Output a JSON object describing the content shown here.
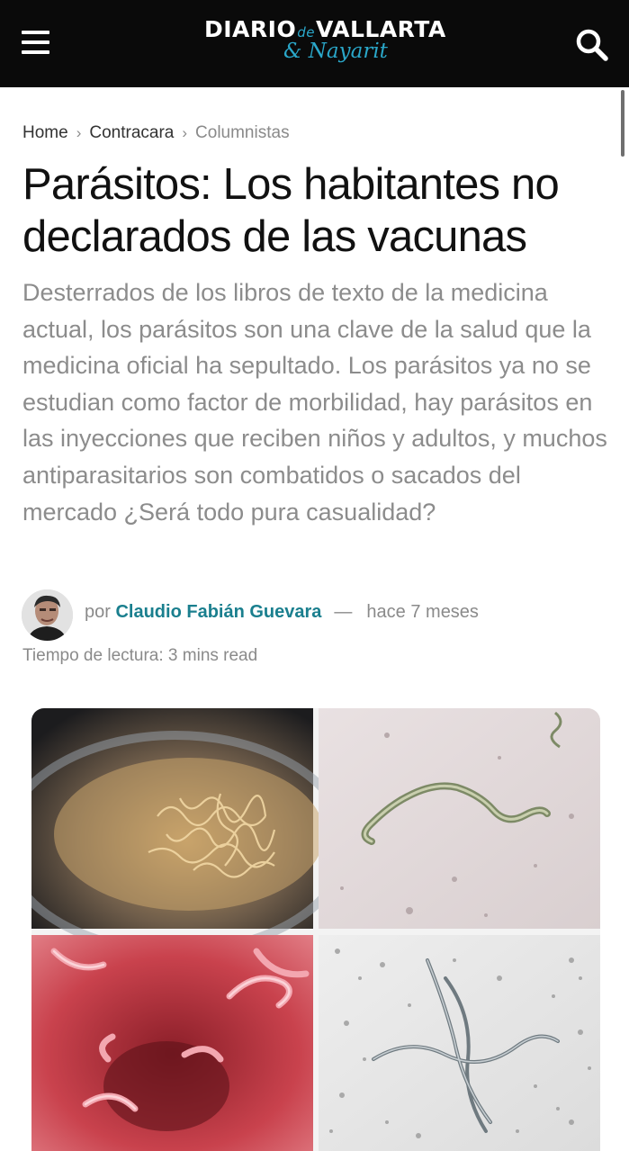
{
  "header": {
    "logo_main_left": "DIARIO",
    "logo_de": "de",
    "logo_main_right": "VALLARTA",
    "logo_sub": "& Nayarit",
    "menu_icon": "hamburger-menu-icon",
    "search_icon": "search-icon",
    "accent_color": "#2aa7c9"
  },
  "breadcrumb": {
    "items": [
      "Home",
      "Contracara",
      "Columnistas"
    ],
    "separator": "›"
  },
  "article": {
    "title": "Parásitos: Los habitantes no declarados de las vacunas",
    "subtitle": "Desterrados de los libros de texto de la medicina actual, los parásitos son una clave de la salud que la medicina oficial ha sepultado. Los parásitos ya no se estudian como factor de morbilidad, hay parásitos en las inyecciones que reciben niños y adultos, y muchos antiparasitarios son combatidos o sacados del mercado ¿Será todo pura casualidad?",
    "byline_prefix": "por",
    "author": "Claudio Fabián Guevara",
    "dash": "—",
    "time_ago": "hace 7 meses",
    "reading_time": "Tiempo de lectura: 3 mins read",
    "author_color": "#1a7f8e"
  }
}
